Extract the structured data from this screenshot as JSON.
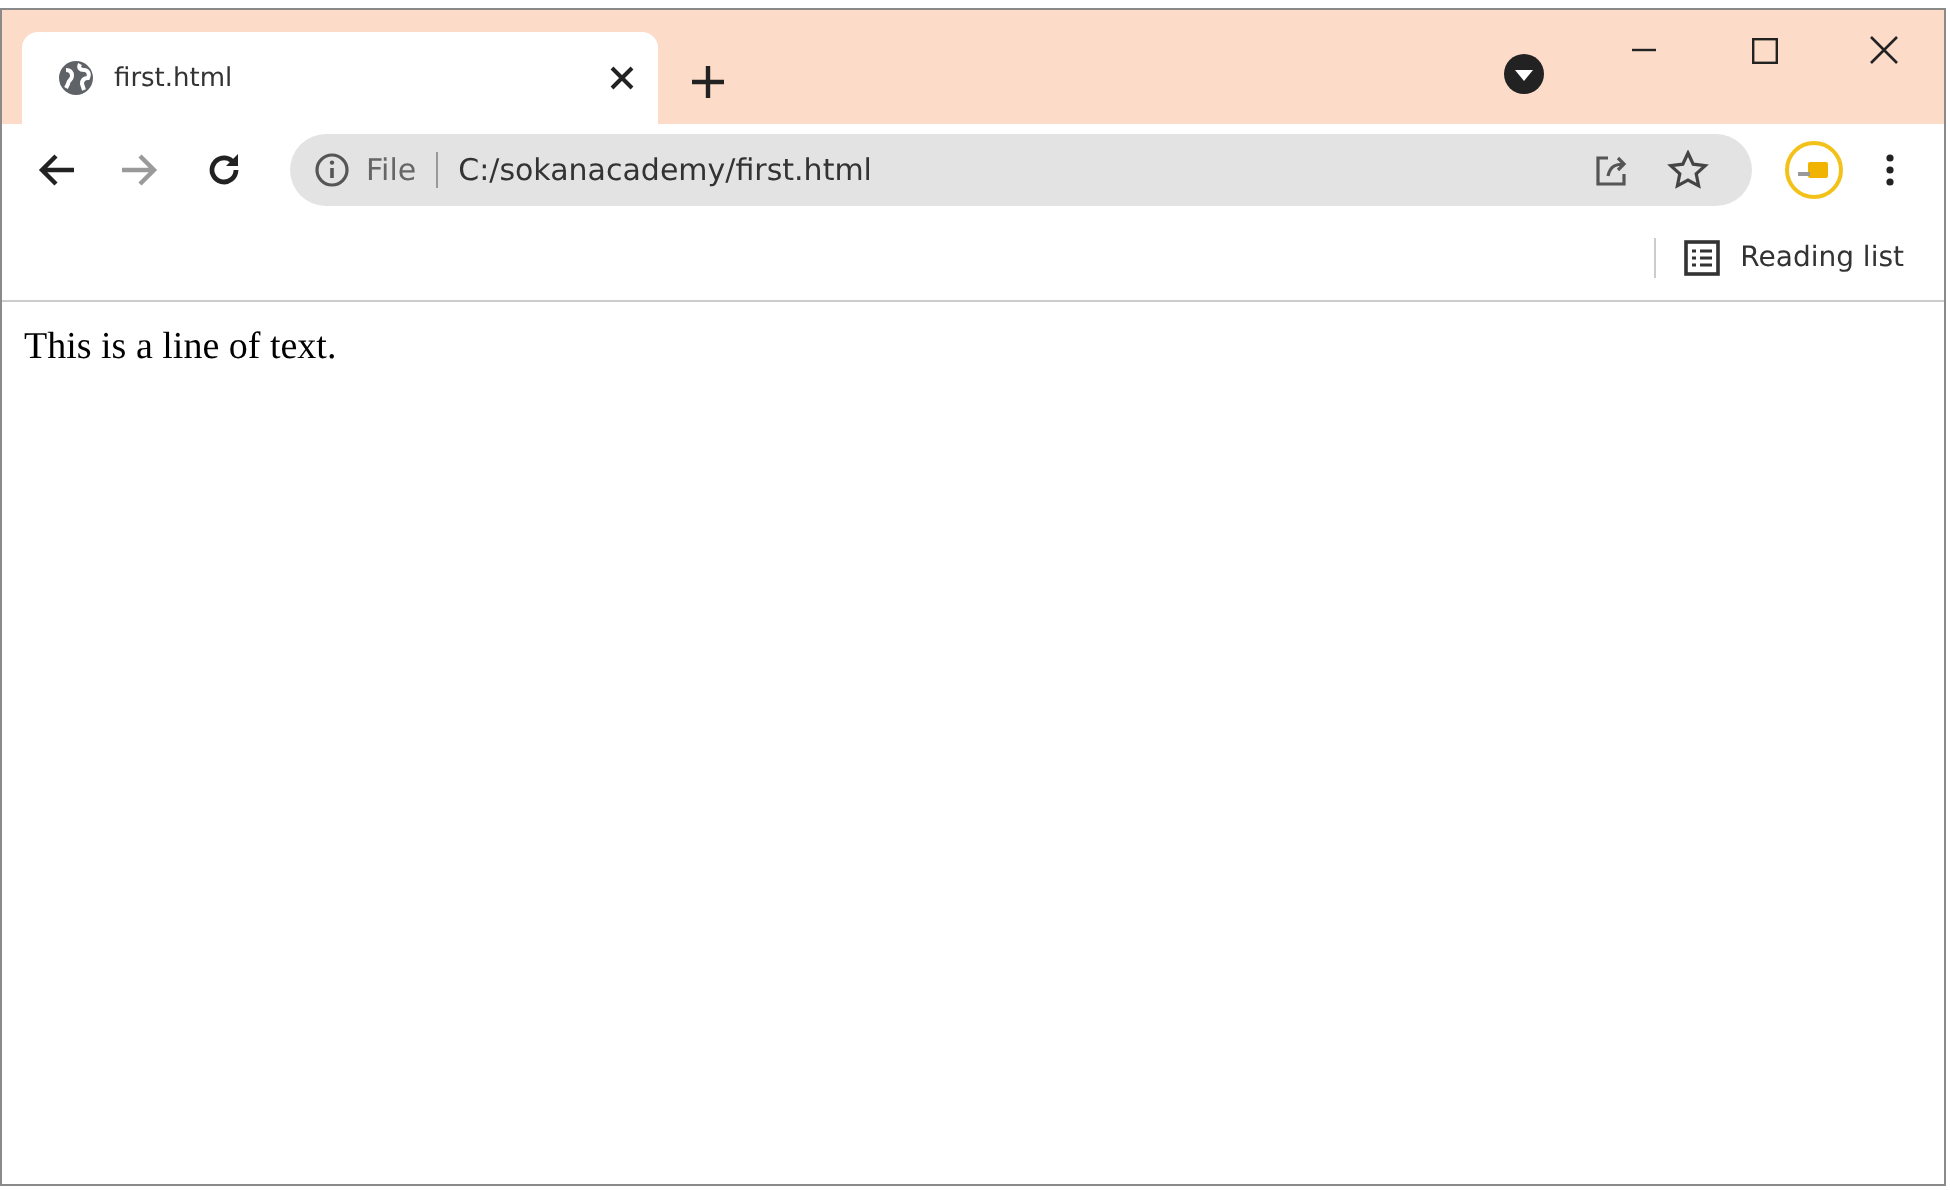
{
  "tabs": [
    {
      "title": "first.html",
      "selected": true
    }
  ],
  "toolbar": {
    "nav": [
      {
        "kind": "back",
        "disabled": false
      },
      {
        "kind": "forward",
        "disabled": true
      },
      {
        "kind": "reload",
        "disabled": false
      }
    ],
    "address": {
      "scheme": "File",
      "url": "C:/sokanacademy/first.html"
    }
  },
  "bookmarks_bar": {
    "reading_list": "Reading list"
  },
  "page": {
    "text": "This is a line of text."
  }
}
